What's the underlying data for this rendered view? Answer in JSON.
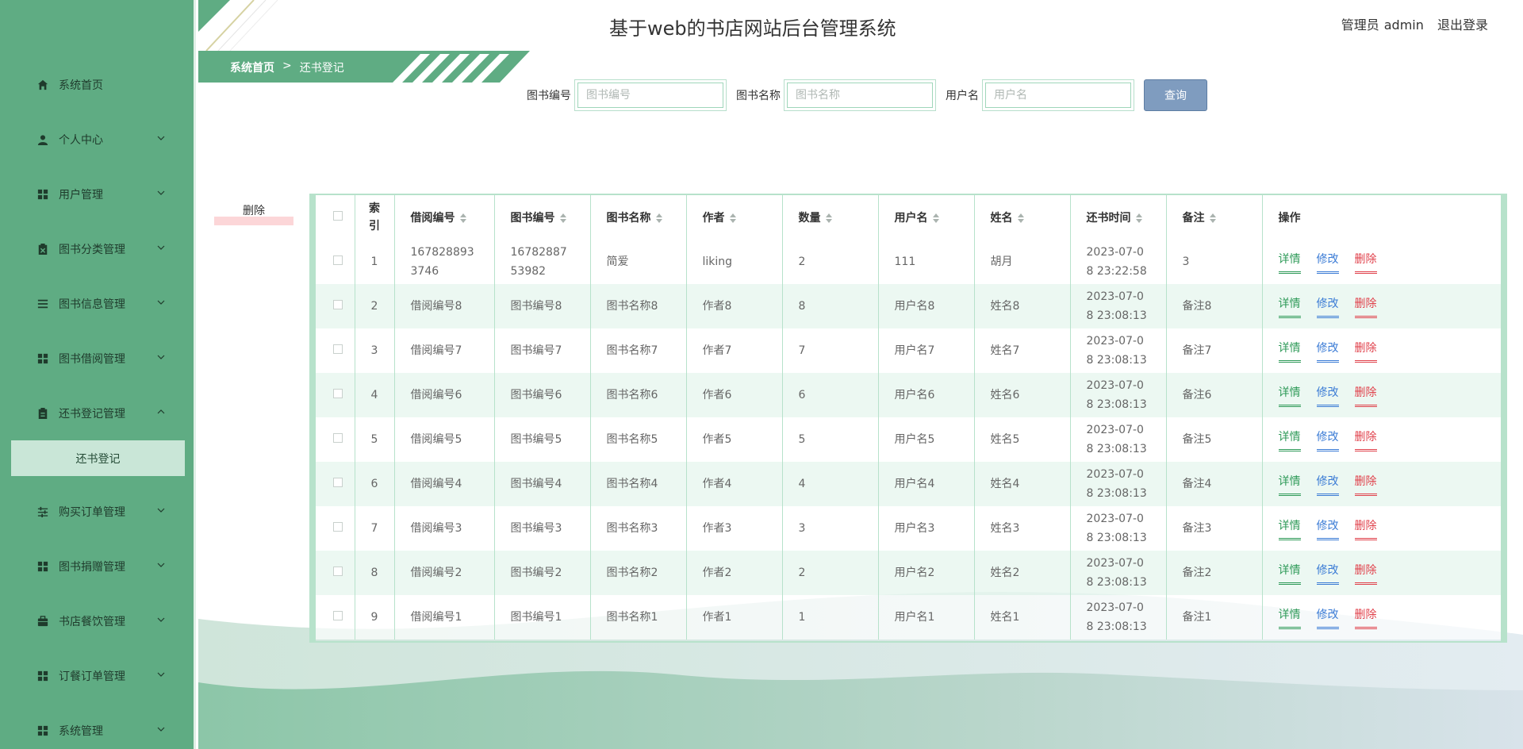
{
  "header": {
    "title": "基于web的书店网站后台管理系统",
    "role": "管理员",
    "username": "admin",
    "logout": "退出登录"
  },
  "breadcrumb": {
    "home": "系统首页",
    "separator": ">",
    "current": "还书登记"
  },
  "sidebar": {
    "items": [
      {
        "label": "系统首页",
        "icon": "home-icon",
        "expandable": false
      },
      {
        "label": "个人中心",
        "icon": "user-icon",
        "expandable": true
      },
      {
        "label": "用户管理",
        "icon": "grid-icon",
        "expandable": true
      },
      {
        "label": "图书分类管理",
        "icon": "clipboard-x-icon",
        "expandable": true
      },
      {
        "label": "图书信息管理",
        "icon": "list-icon",
        "expandable": true
      },
      {
        "label": "图书借阅管理",
        "icon": "grid-icon",
        "expandable": true
      },
      {
        "label": "还书登记管理",
        "icon": "clipboard-icon",
        "expandable": true,
        "expanded": true
      },
      {
        "label": "购买订单管理",
        "icon": "sliders-icon",
        "expandable": true
      },
      {
        "label": "图书捐赠管理",
        "icon": "grid-icon",
        "expandable": true
      },
      {
        "label": "书店餐饮管理",
        "icon": "briefcase-icon",
        "expandable": true
      },
      {
        "label": "订餐订单管理",
        "icon": "grid-icon",
        "expandable": true
      },
      {
        "label": "系统管理",
        "icon": "grid-icon",
        "expandable": true
      }
    ],
    "active_submenu": "还书登记"
  },
  "search": {
    "book_no_label": "图书编号",
    "book_no_placeholder": "图书编号",
    "book_name_label": "图书名称",
    "book_name_placeholder": "图书名称",
    "username_label": "用户名",
    "username_placeholder": "用户名",
    "query_button": "查询"
  },
  "actions": {
    "delete_button": "删除"
  },
  "table": {
    "headers": {
      "index": "索引",
      "borrow_no": "借阅编号",
      "book_no": "图书编号",
      "book_name": "图书名称",
      "author": "作者",
      "quantity": "数量",
      "username": "用户名",
      "name": "姓名",
      "return_time": "还书时间",
      "remark": "备注",
      "ops": "操作"
    },
    "op_labels": {
      "detail": "详情",
      "edit": "修改",
      "delete": "删除"
    },
    "rows": [
      {
        "index": "1",
        "borrow_no": "1678288933746",
        "book_no": "1678288753982",
        "book_name": "简爱",
        "author": "liking",
        "quantity": "2",
        "username": "111",
        "name": "胡月",
        "return_time": "2023-07-08 23:22:58",
        "remark": "3"
      },
      {
        "index": "2",
        "borrow_no": "借阅编号8",
        "book_no": "图书编号8",
        "book_name": "图书名称8",
        "author": "作者8",
        "quantity": "8",
        "username": "用户名8",
        "name": "姓名8",
        "return_time": "2023-07-08 23:08:13",
        "remark": "备注8"
      },
      {
        "index": "3",
        "borrow_no": "借阅编号7",
        "book_no": "图书编号7",
        "book_name": "图书名称7",
        "author": "作者7",
        "quantity": "7",
        "username": "用户名7",
        "name": "姓名7",
        "return_time": "2023-07-08 23:08:13",
        "remark": "备注7"
      },
      {
        "index": "4",
        "borrow_no": "借阅编号6",
        "book_no": "图书编号6",
        "book_name": "图书名称6",
        "author": "作者6",
        "quantity": "6",
        "username": "用户名6",
        "name": "姓名6",
        "return_time": "2023-07-08 23:08:13",
        "remark": "备注6"
      },
      {
        "index": "5",
        "borrow_no": "借阅编号5",
        "book_no": "图书编号5",
        "book_name": "图书名称5",
        "author": "作者5",
        "quantity": "5",
        "username": "用户名5",
        "name": "姓名5",
        "return_time": "2023-07-08 23:08:13",
        "remark": "备注5"
      },
      {
        "index": "6",
        "borrow_no": "借阅编号4",
        "book_no": "图书编号4",
        "book_name": "图书名称4",
        "author": "作者4",
        "quantity": "4",
        "username": "用户名4",
        "name": "姓名4",
        "return_time": "2023-07-08 23:08:13",
        "remark": "备注4"
      },
      {
        "index": "7",
        "borrow_no": "借阅编号3",
        "book_no": "图书编号3",
        "book_name": "图书名称3",
        "author": "作者3",
        "quantity": "3",
        "username": "用户名3",
        "name": "姓名3",
        "return_time": "2023-07-08 23:08:13",
        "remark": "备注3"
      },
      {
        "index": "8",
        "borrow_no": "借阅编号2",
        "book_no": "图书编号2",
        "book_name": "图书名称2",
        "author": "作者2",
        "quantity": "2",
        "username": "用户名2",
        "name": "姓名2",
        "return_time": "2023-07-08 23:08:13",
        "remark": "备注2"
      },
      {
        "index": "9",
        "borrow_no": "借阅编号1",
        "book_no": "图书编号1",
        "book_name": "图书名称1",
        "author": "作者1",
        "quantity": "1",
        "username": "用户名1",
        "name": "姓名1",
        "return_time": "2023-07-08 23:08:13",
        "remark": "备注1"
      }
    ]
  },
  "colors": {
    "sidebar_bg": "#5fac83",
    "accent": "#b7e2cb",
    "query_btn": "#7f9cbf",
    "detail": "#2e9a58",
    "edit": "#3a7bd5",
    "delete": "#e0414b"
  }
}
